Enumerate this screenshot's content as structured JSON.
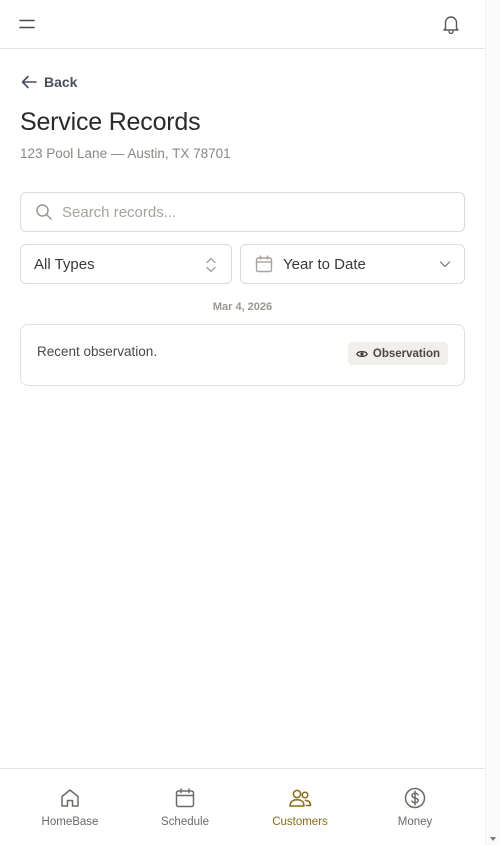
{
  "header": {
    "menu_icon": "menu-icon",
    "bell_icon": "bell-icon"
  },
  "back": {
    "label": "Back",
    "icon": "arrow-left-icon"
  },
  "page": {
    "title": "Service Records",
    "address": "123 Pool Lane — Austin, TX 78701"
  },
  "search": {
    "placeholder": "Search records...",
    "value": ""
  },
  "filters": {
    "type_value": "All Types",
    "range_value": "Year to Date"
  },
  "records": [
    {
      "date": "Mar 4, 2026",
      "text": "Recent observation.",
      "badge": "Observation",
      "badge_icon": "eye-icon"
    }
  ],
  "nav": {
    "items": [
      {
        "label": "HomeBase",
        "icon": "home-icon",
        "active": false
      },
      {
        "label": "Schedule",
        "icon": "calendar-icon",
        "active": false
      },
      {
        "label": "Customers",
        "icon": "users-icon",
        "active": true
      },
      {
        "label": "Money",
        "icon": "dollar-circle-icon",
        "active": false
      }
    ]
  },
  "colors": {
    "accent": "#8a6a1a",
    "text": "#2b2a28",
    "muted": "#8a8782",
    "border": "#dcdad6"
  }
}
